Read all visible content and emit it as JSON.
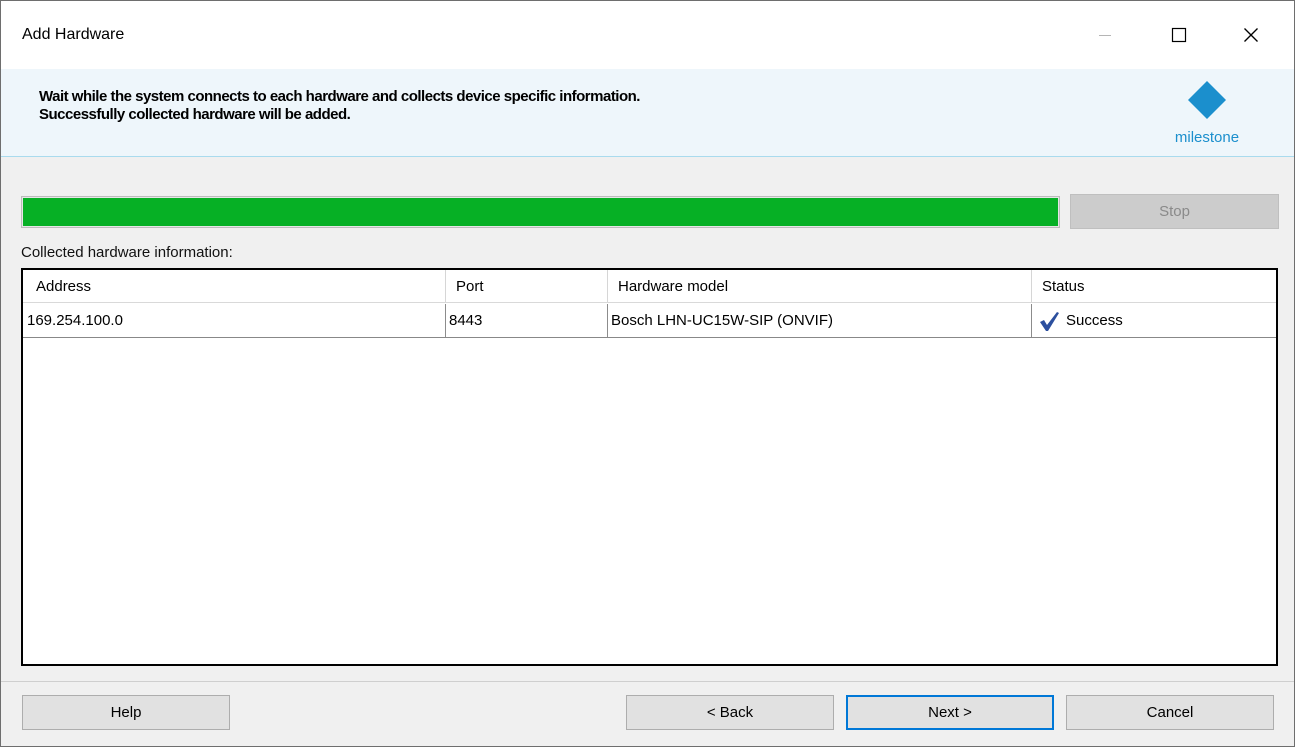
{
  "window": {
    "title": "Add Hardware",
    "controls": {
      "minimize": "minimize-icon",
      "maximize": "maximize-icon",
      "close": "close-icon"
    }
  },
  "header": {
    "line1": "Wait while the system connects to each hardware and collects device specific information.",
    "line2": "Successfully collected hardware will be added.",
    "logo_text": "milestone",
    "logo_color": "#1b8fcd"
  },
  "progress": {
    "fraction": 1.0,
    "color": "#06b025",
    "stop_label": "Stop"
  },
  "section_label": "Collected hardware information:",
  "table": {
    "columns": [
      "Address",
      "Port",
      "Hardware model",
      "Status"
    ],
    "rows": [
      {
        "address": "169.254.100.0",
        "port": "8443",
        "model": "Bosch LHN-UC15W-SIP (ONVIF)",
        "status": "Success",
        "status_icon": "checkmark-icon"
      }
    ]
  },
  "footer": {
    "help_label": "Help",
    "back_label": "< Back",
    "next_label": "Next >",
    "cancel_label": "Cancel"
  }
}
